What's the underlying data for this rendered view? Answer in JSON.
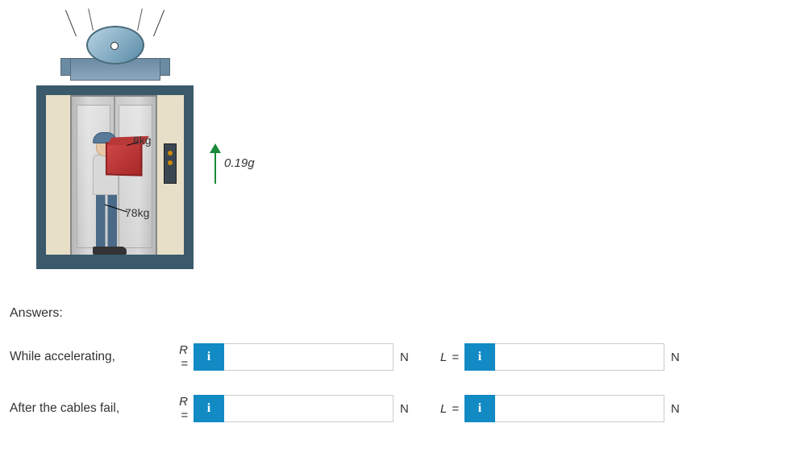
{
  "diagram": {
    "box_mass_label": "8kg",
    "person_mass_label": "78kg",
    "acceleration_label": "0.19g"
  },
  "answers_heading": "Answers:",
  "rows": [
    {
      "label": "While accelerating,",
      "var1": "R =",
      "unit1": "N",
      "var2": "L =",
      "unit2": "N",
      "info_icon": "i",
      "value1": "",
      "value2": ""
    },
    {
      "label": "After the cables fail,",
      "var1": "R =",
      "unit1": "N",
      "var2": "L =",
      "unit2": "N",
      "info_icon": "i",
      "value1": "",
      "value2": ""
    }
  ]
}
